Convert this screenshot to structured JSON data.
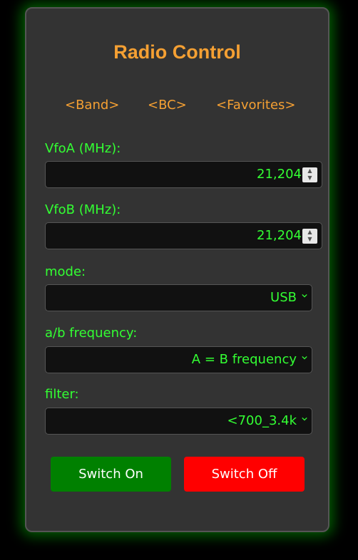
{
  "title": "Radio Control",
  "nav": {
    "band": "<Band>",
    "bc": "<BC>",
    "favorites": "<Favorites>"
  },
  "vfoA": {
    "label": "VfoA (MHz):",
    "value": "21,204"
  },
  "vfoB": {
    "label": "VfoB (MHz):",
    "value": "21,204"
  },
  "mode": {
    "label": "mode:",
    "value": "USB"
  },
  "ab_frequency": {
    "label": "a/b frequency:",
    "value": "A = B frequency"
  },
  "filter": {
    "label": "filter:",
    "value": "<700_3.4k"
  },
  "buttons": {
    "switch_on": "Switch On",
    "switch_off": "Switch Off"
  },
  "colors": {
    "accent_orange": "#f5a033",
    "text_green": "#33ff33",
    "panel_bg": "#333333",
    "on_button": "#008000",
    "off_button": "#ff0000"
  }
}
